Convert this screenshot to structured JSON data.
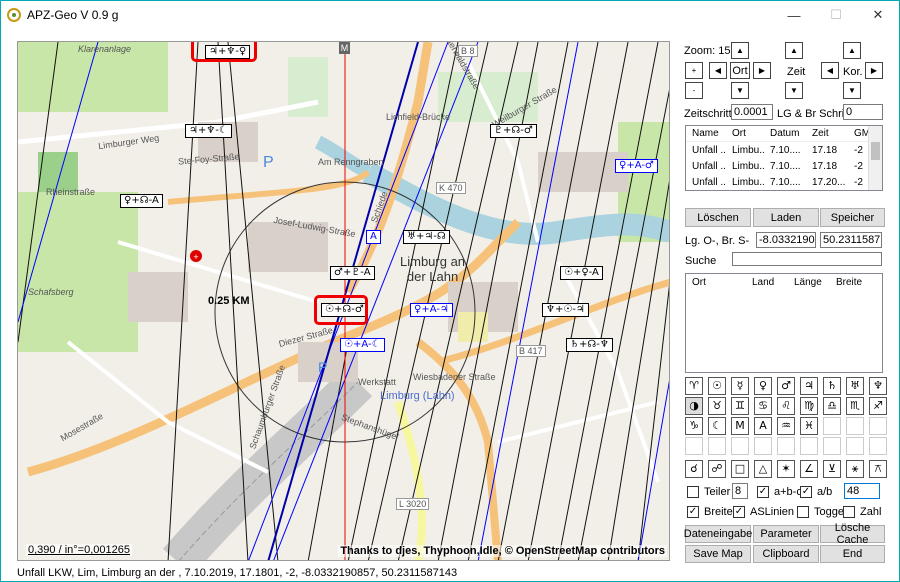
{
  "window": {
    "title": "APZ-Geo V 0.9 g",
    "minimize": "—",
    "maximize": "☐",
    "close": "✕"
  },
  "map": {
    "scale_text": "0,390 / in°=0,001265",
    "attribution": "Thanks to djes, Thyphoon,Idle,  © OpenStreetMap contributors",
    "marker": "M",
    "km_label": "0.25 KM",
    "town_label_1": "Limburg an",
    "town_label_2": "der Lahn",
    "street_labels": [
      "Limburger Weg",
      "Ste-Foy-Straße",
      "Rheinstraße",
      "Schafsberg",
      "Diezer Straße",
      "Schiede",
      "Lichfield-Brücke",
      "Am Renngraben",
      "Wiesbadener Straße",
      "Limburg (Lahn)",
      "B 8",
      "B 417",
      "L 3020",
      "K 470",
      "Josef-Ludwig-Straße",
      "Werkstatt",
      "Westerwaldstraße",
      "Weilburger Straße",
      "Mosestraße",
      "Schaumburger Straße",
      "Stephanshügel",
      "Klarenanlage"
    ],
    "aspects": [
      {
        "text": "♃+♆-♀",
        "color": "black"
      },
      {
        "text": "♃+♆-☾",
        "color": "black"
      },
      {
        "text": "♀+☊-A",
        "color": "black"
      },
      {
        "text": "♇+☊-♂",
        "color": "black"
      },
      {
        "text": "♀+A-♂",
        "color": "blue"
      },
      {
        "text": "♅+♃-☊",
        "color": "black"
      },
      {
        "text": "♂+♇-A",
        "color": "black"
      },
      {
        "text": "☉+♀-A",
        "color": "black"
      },
      {
        "text": "☉+☊-♂",
        "color": "black"
      },
      {
        "text": "♀+A-♃",
        "color": "blue"
      },
      {
        "text": "♆+☉-♃",
        "color": "black"
      },
      {
        "text": "☉+A-☾",
        "color": "blue"
      },
      {
        "text": "♄+☊-♆",
        "color": "black"
      },
      {
        "text": "A",
        "color": "blue"
      }
    ]
  },
  "panel": {
    "zoom_label": "Zoom: 15",
    "ort_label": "Ort",
    "zeit_label": "Zeit",
    "kor_label": "Kor.",
    "plus": "+",
    "minus": "-",
    "zeitschritt_label": "Zeitschritt",
    "zeitschritt_value": "0.0001",
    "lgbr_label": "LG & Br Schritt",
    "lgbr_value": "0",
    "table1": {
      "headers": [
        "Name",
        "Ort",
        "Datum",
        "Zeit",
        "GM"
      ],
      "rows": [
        [
          "Unfall ...",
          "Limbu...",
          "7.10....",
          "17.18",
          "-2"
        ],
        [
          "Unfall ...",
          "Limbu...",
          "7.10....",
          "17.18",
          "-2"
        ],
        [
          "Unfall ...",
          "Limbu...",
          "7.10....",
          "17.20...",
          "-2"
        ]
      ]
    },
    "loeschen": "Löschen",
    "laden": "Laden",
    "speicher": "Speicher",
    "lg_label": "Lg. O-, Br. S-",
    "lg_value": "-8.03321908",
    "br_value": "50.23115871",
    "suche_label": "Suche",
    "suche_value": "",
    "table2": {
      "headers": [
        "Ort",
        "Land",
        "Länge",
        "Breite"
      ]
    },
    "symbols_row1": [
      "♈",
      "☉",
      "☿",
      "♀",
      "♂",
      "♃",
      "♄",
      "♅",
      "♆"
    ],
    "symbols_row2": [
      "◑",
      "♉",
      "♊",
      "♋",
      "♌",
      "♍",
      "♎",
      "♏",
      "♐"
    ],
    "symbols_row3": [
      "♑",
      "☾",
      "M",
      "A",
      "♒",
      "♓",
      "",
      "",
      ""
    ],
    "symbols_row5": [
      "☌",
      "☍",
      "□",
      "△",
      "✶",
      "∠",
      "⊻",
      "⚹",
      "⚻"
    ],
    "teiler_label": "Teiler",
    "teiler_value": "8",
    "abc_label": "a+b-c",
    "ab_label": "a/b",
    "ab_value": "48",
    "breite_label": "Breite",
    "aslinien_label": "ASLinien",
    "togge_label": "Togge",
    "zahl_label": "Zahl",
    "dateneingabe": "Dateneingabe",
    "parameter": "Parameter",
    "loesche_cache": "Lösche Cache",
    "save_map": "Save Map",
    "clipboard": "Clipboard",
    "end": "End"
  },
  "status": "Unfall LKW, Lim, Limburg an der , 7.10.2019, 17.1801, -2, -8.0332190857, 50.2311587143"
}
